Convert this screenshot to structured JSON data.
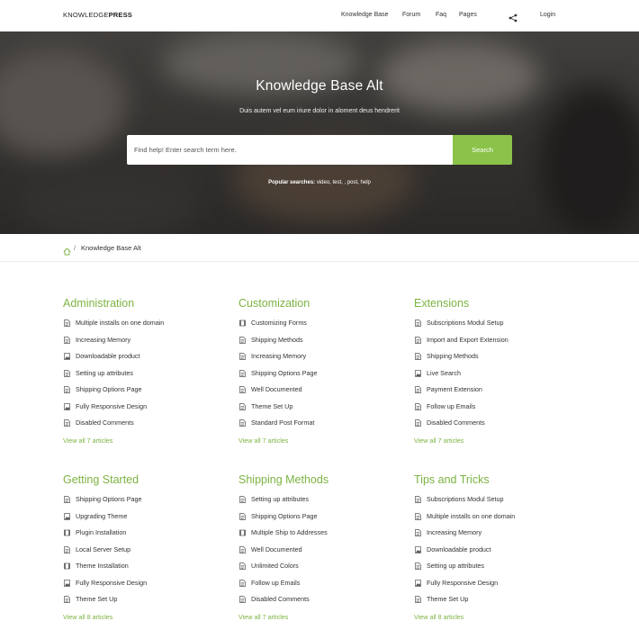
{
  "header": {
    "logo_light": "KNOWLEDGE",
    "logo_bold": "PRESS",
    "nav": [
      "Knowledge Base",
      "Forum",
      "Faq",
      "Pages"
    ],
    "share_icon": "share-icon",
    "login_label": "Login"
  },
  "hero": {
    "title": "Knowledge Base Alt",
    "subtitle": "Duis autem vel eum iriure dolor in aloment deus hendrerit",
    "search_placeholder": "Find help! Enter search term here.",
    "search_button": "Search",
    "popular_label": "Popular searches:",
    "popular_terms": "video, test, , post, help"
  },
  "breadcrumb": {
    "home_icon": "home-icon",
    "separator": "/",
    "current": "Knowledge Base Alt"
  },
  "colors": {
    "accent": "#8bc34a",
    "title_green": "#7cb342"
  },
  "categories": [
    {
      "title": "Administration",
      "items": [
        {
          "label": "Multiple installs on one domain",
          "icon": "document-icon"
        },
        {
          "label": "Increasing Memory",
          "icon": "document-icon"
        },
        {
          "label": "Downloadable product",
          "icon": "image-icon"
        },
        {
          "label": "Setting up attributes",
          "icon": "document-icon"
        },
        {
          "label": "Shipping Options Page",
          "icon": "document-icon"
        },
        {
          "label": "Fully Responsive Design",
          "icon": "image-icon"
        },
        {
          "label": "Disabled Comments",
          "icon": "document-icon"
        }
      ],
      "view_all": "View all 7 articles"
    },
    {
      "title": "Customization",
      "items": [
        {
          "label": "Customizing Forms",
          "icon": "video-icon"
        },
        {
          "label": "Shipping Methods",
          "icon": "document-icon"
        },
        {
          "label": "Increasing Memory",
          "icon": "document-icon"
        },
        {
          "label": "Shipping Options Page",
          "icon": "document-icon"
        },
        {
          "label": "Well Documented",
          "icon": "document-icon"
        },
        {
          "label": "Theme Set Up",
          "icon": "document-icon"
        },
        {
          "label": "Standard Post Format",
          "icon": "document-icon"
        }
      ],
      "view_all": "View all 7 articles"
    },
    {
      "title": "Extensions",
      "items": [
        {
          "label": "Subscriptions Modul Setup",
          "icon": "document-icon"
        },
        {
          "label": "Import and Export Extension",
          "icon": "document-icon"
        },
        {
          "label": "Shipping Methods",
          "icon": "document-icon"
        },
        {
          "label": "Live Search",
          "icon": "image-icon"
        },
        {
          "label": "Payment Extension",
          "icon": "document-icon"
        },
        {
          "label": "Follow up Emails",
          "icon": "document-icon"
        },
        {
          "label": "Disabled Comments",
          "icon": "document-icon"
        }
      ],
      "view_all": "View all 7 articles"
    },
    {
      "title": "Getting Started",
      "items": [
        {
          "label": "Shipping Options Page",
          "icon": "document-icon"
        },
        {
          "label": "Upgrading Theme",
          "icon": "image-icon"
        },
        {
          "label": "Plugin Installation",
          "icon": "video-icon"
        },
        {
          "label": "Local Server Setup",
          "icon": "document-icon"
        },
        {
          "label": "Theme Installation",
          "icon": "video-icon"
        },
        {
          "label": "Fully Responsive Design",
          "icon": "image-icon"
        },
        {
          "label": "Theme Set Up",
          "icon": "document-icon"
        }
      ],
      "view_all": "View all 8 articles"
    },
    {
      "title": "Shipping Methods",
      "items": [
        {
          "label": "Setting up attributes",
          "icon": "document-icon"
        },
        {
          "label": "Shipping Options Page",
          "icon": "document-icon"
        },
        {
          "label": "Multiple Ship to Addresses",
          "icon": "video-icon"
        },
        {
          "label": "Well Documented",
          "icon": "document-icon"
        },
        {
          "label": "Unlimited Colors",
          "icon": "document-icon"
        },
        {
          "label": "Follow up Emails",
          "icon": "document-icon"
        },
        {
          "label": "Disabled Comments",
          "icon": "document-icon"
        }
      ],
      "view_all": "View all 7 articles"
    },
    {
      "title": "Tips and Tricks",
      "items": [
        {
          "label": "Subscriptions Modul Setup",
          "icon": "document-icon"
        },
        {
          "label": "Multiple installs on one domain",
          "icon": "document-icon"
        },
        {
          "label": "Increasing Memory",
          "icon": "document-icon"
        },
        {
          "label": "Downloadable product",
          "icon": "image-icon"
        },
        {
          "label": "Setting up attributes",
          "icon": "document-icon"
        },
        {
          "label": "Fully Responsive Design",
          "icon": "image-icon"
        },
        {
          "label": "Theme Set Up",
          "icon": "document-icon"
        }
      ],
      "view_all": "View all 8 articles"
    }
  ]
}
